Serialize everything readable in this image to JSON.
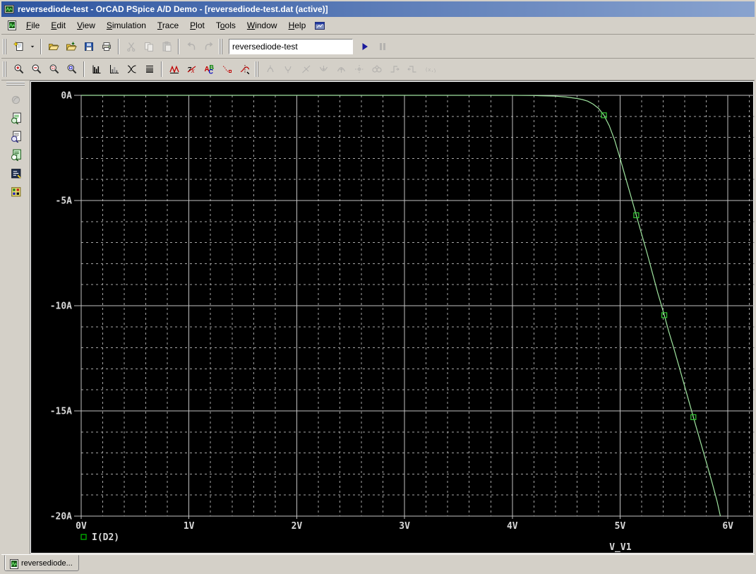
{
  "window": {
    "title": "reversediode-test - OrCAD PSpice A/D Demo  - [reversediode-test.dat (active)]"
  },
  "menu_bar": {
    "items": [
      {
        "label": "File",
        "accel": 0
      },
      {
        "label": "Edit",
        "accel": 0
      },
      {
        "label": "View",
        "accel": 0
      },
      {
        "label": "Simulation",
        "accel": 0
      },
      {
        "label": "Trace",
        "accel": 0
      },
      {
        "label": "Plot",
        "accel": 0
      },
      {
        "label": "Tools",
        "accel": 1
      },
      {
        "label": "Window",
        "accel": 0
      },
      {
        "label": "Help",
        "accel": 0
      }
    ],
    "left_icon": "pspice-document-icon",
    "right_icon": "schematic-window-icon"
  },
  "toolbar_main": {
    "groups": [
      {
        "buttons": [
          {
            "name": "new-simulation",
            "icon": "new-page",
            "enabled": true
          },
          {
            "name": "new-dropdown",
            "icon": "dropdown-arrow",
            "enabled": true,
            "narrow": true
          }
        ]
      },
      {
        "buttons": [
          {
            "name": "open",
            "icon": "folder-open",
            "enabled": true
          },
          {
            "name": "open-append",
            "icon": "folder-append",
            "enabled": true
          },
          {
            "name": "save",
            "icon": "floppy",
            "enabled": true
          },
          {
            "name": "print",
            "icon": "printer",
            "enabled": true
          }
        ]
      },
      {
        "buttons": [
          {
            "name": "cut",
            "icon": "scissors",
            "enabled": false
          },
          {
            "name": "copy",
            "icon": "copy-pages",
            "enabled": false
          },
          {
            "name": "paste",
            "icon": "clipboard",
            "enabled": false
          }
        ]
      },
      {
        "buttons": [
          {
            "name": "undo",
            "icon": "undo-arrow",
            "enabled": false
          },
          {
            "name": "redo",
            "icon": "redo-arrow",
            "enabled": false
          }
        ]
      }
    ],
    "profile_combo": {
      "value": "reversediode-test"
    },
    "run_button": {
      "name": "run-simulation",
      "icon": "play",
      "enabled": true
    },
    "pause_button": {
      "name": "pause-simulation",
      "icon": "pause",
      "enabled": false
    }
  },
  "toolbar_plot": {
    "groups": [
      {
        "buttons": [
          {
            "name": "zoom-in",
            "icon": "zoom-in",
            "enabled": true
          },
          {
            "name": "zoom-out",
            "icon": "zoom-out",
            "enabled": true
          },
          {
            "name": "zoom-area",
            "icon": "zoom-area",
            "enabled": true
          },
          {
            "name": "zoom-fit",
            "icon": "zoom-fit",
            "enabled": true
          }
        ]
      },
      {
        "buttons": [
          {
            "name": "fft",
            "icon": "fft",
            "enabled": true
          },
          {
            "name": "performance-analysis",
            "icon": "performance",
            "enabled": true
          },
          {
            "name": "log-x-axis",
            "icon": "log-x",
            "enabled": true
          },
          {
            "name": "log-y-axis",
            "icon": "log-y",
            "enabled": true
          }
        ]
      },
      {
        "buttons": [
          {
            "name": "add-trace",
            "icon": "add-trace",
            "enabled": true
          },
          {
            "name": "eval-goal-function",
            "icon": "eval-goal",
            "enabled": true
          },
          {
            "name": "text-label",
            "icon": "abc-label",
            "enabled": true
          },
          {
            "name": "mark-data-points",
            "icon": "mark-points",
            "enabled": true
          },
          {
            "name": "toggle-cursor",
            "icon": "cursor-toggle",
            "enabled": true
          }
        ]
      },
      {
        "grip_before": true,
        "buttons": [
          {
            "name": "cursor-peak",
            "icon": "cursor-g1",
            "enabled": false
          },
          {
            "name": "cursor-trough",
            "icon": "cursor-g2",
            "enabled": false
          },
          {
            "name": "cursor-slope",
            "icon": "cursor-g3",
            "enabled": false
          },
          {
            "name": "cursor-min",
            "icon": "cursor-g4",
            "enabled": false
          },
          {
            "name": "cursor-max",
            "icon": "cursor-g5",
            "enabled": false
          },
          {
            "name": "cursor-point",
            "icon": "cursor-g6",
            "enabled": false
          },
          {
            "name": "cursor-search",
            "icon": "cursor-g7",
            "enabled": false
          },
          {
            "name": "cursor-next-transition",
            "icon": "cursor-g8",
            "enabled": false
          },
          {
            "name": "cursor-previous-transition",
            "icon": "cursor-g9",
            "enabled": false
          },
          {
            "name": "mark-label",
            "icon": "cursor-g10",
            "enabled": false
          }
        ]
      }
    ]
  },
  "left_toolbar": {
    "buttons": [
      {
        "name": "simulation-status",
        "icon": "status-ball",
        "enabled": false
      },
      {
        "name": "view-simulation-output-file",
        "icon": "doc-wave-magnifier",
        "enabled": true
      },
      {
        "name": "view-circuit-file",
        "icon": "doc-text-magnifier",
        "enabled": true
      },
      {
        "name": "view-simulation-results",
        "icon": "doc-green-magnifier",
        "enabled": true
      },
      {
        "name": "simulation-output-window",
        "icon": "console-window",
        "enabled": true
      },
      {
        "name": "simulation-queue",
        "icon": "queue-grid",
        "enabled": true
      }
    ]
  },
  "tab_bar": {
    "tabs": [
      {
        "label": "reversediode...",
        "icon": "pspice-document-icon",
        "active": true
      }
    ]
  },
  "chart_data": {
    "type": "line",
    "title": "",
    "xlabel": "V_V1",
    "ylabel": "",
    "xlim": [
      0,
      6.27
    ],
    "ylim": [
      -20,
      0
    ],
    "x_ticks": [
      {
        "value": 0,
        "label": "0V"
      },
      {
        "value": 1,
        "label": "1V"
      },
      {
        "value": 2,
        "label": "2V"
      },
      {
        "value": 3,
        "label": "3V"
      },
      {
        "value": 4,
        "label": "4V"
      },
      {
        "value": 5,
        "label": "5V"
      },
      {
        "value": 6,
        "label": "6V"
      }
    ],
    "y_ticks": [
      {
        "value": 0,
        "label": "0A"
      },
      {
        "value": -5,
        "label": "-5A"
      },
      {
        "value": -10,
        "label": "-10A"
      },
      {
        "value": -15,
        "label": "-15A"
      },
      {
        "value": -20,
        "label": "-20A"
      }
    ],
    "grid": {
      "minor_x_step": 0.2,
      "major_x_step": 1,
      "minor_y_step": 1,
      "major_y_step": 5
    },
    "legend": {
      "position": "bottom-left",
      "entries": [
        {
          "label": "I(D2)",
          "symbol": "open-square",
          "color": "#00B400"
        }
      ]
    },
    "series": [
      {
        "name": "I(D2)",
        "color": "#9FE49F",
        "x": [
          0,
          0.5,
          1,
          1.5,
          2,
          2.5,
          3,
          3.5,
          4,
          4.2,
          4.4,
          4.5,
          4.6,
          4.65,
          4.7,
          4.75,
          4.8,
          4.85,
          4.9,
          4.95,
          5.0,
          5.05,
          5.1,
          5.15,
          5.2,
          5.25,
          5.3,
          5.35,
          5.41,
          5.45,
          5.5,
          5.55,
          5.6,
          5.68,
          5.75,
          5.8,
          5.85,
          5.9,
          5.93
        ],
        "y": [
          0,
          0,
          0,
          0,
          0,
          0,
          0,
          0,
          0,
          -0.01,
          -0.04,
          -0.08,
          -0.15,
          -0.2,
          -0.28,
          -0.42,
          -0.62,
          -0.95,
          -1.45,
          -2.15,
          -3.0,
          -3.9,
          -4.8,
          -5.7,
          -6.6,
          -7.5,
          -8.45,
          -9.4,
          -10.45,
          -11.2,
          -12.05,
          -12.95,
          -13.85,
          -15.3,
          -16.55,
          -17.45,
          -18.35,
          -19.3,
          -20.0
        ],
        "marker_points": [
          [
            4.85,
            -0.95
          ],
          [
            5.15,
            -5.7
          ],
          [
            5.41,
            -10.45
          ],
          [
            5.68,
            -15.3
          ]
        ]
      }
    ],
    "colors": {
      "background": "#000000",
      "grid_major": "#C2C2C2",
      "grid_minor": "#A6A6A6",
      "tick_text": "#D8D8D8",
      "marker": "#35C835"
    }
  }
}
